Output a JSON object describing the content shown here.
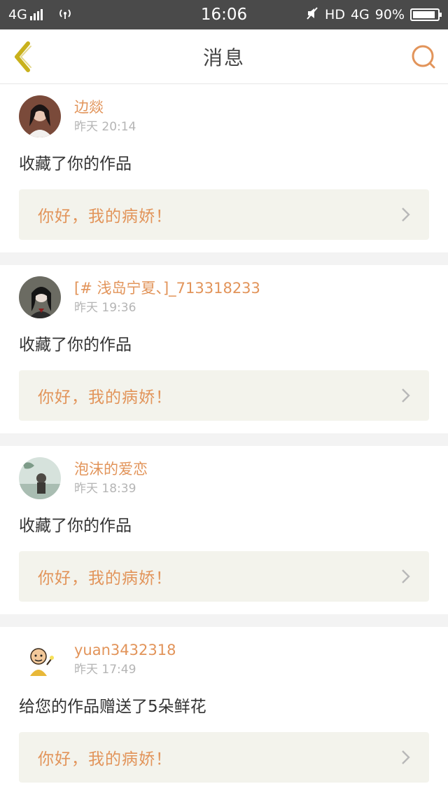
{
  "status_bar": {
    "network": "4G",
    "time": "16:06",
    "hd": "HD",
    "network_right": "4G",
    "battery_percent": "90%",
    "battery_level": 0.9
  },
  "header": {
    "title": "消息",
    "back_icon": "chevron-left-icon",
    "search_icon": "search-icon",
    "accent_color": "#e2945a",
    "back_color": "#c9b11c"
  },
  "messages": [
    {
      "user": "边燚",
      "time": "昨天 20:14",
      "action": "收藏了你的作品",
      "work_title": "你好，我的病娇！"
    },
    {
      "user": "[# 浅岛宁夏、]_713318233",
      "time": "昨天 19:36",
      "action": "收藏了你的作品",
      "work_title": "你好，我的病娇！"
    },
    {
      "user": "泡沫的爱恋",
      "time": "昨天 18:39",
      "action": "收藏了你的作品",
      "work_title": "你好，我的病娇！"
    },
    {
      "user": "yuan3432318",
      "time": "昨天 17:49",
      "action": "给您的作品赠送了5朵鲜花",
      "work_title": "你好，我的病娇！"
    }
  ]
}
